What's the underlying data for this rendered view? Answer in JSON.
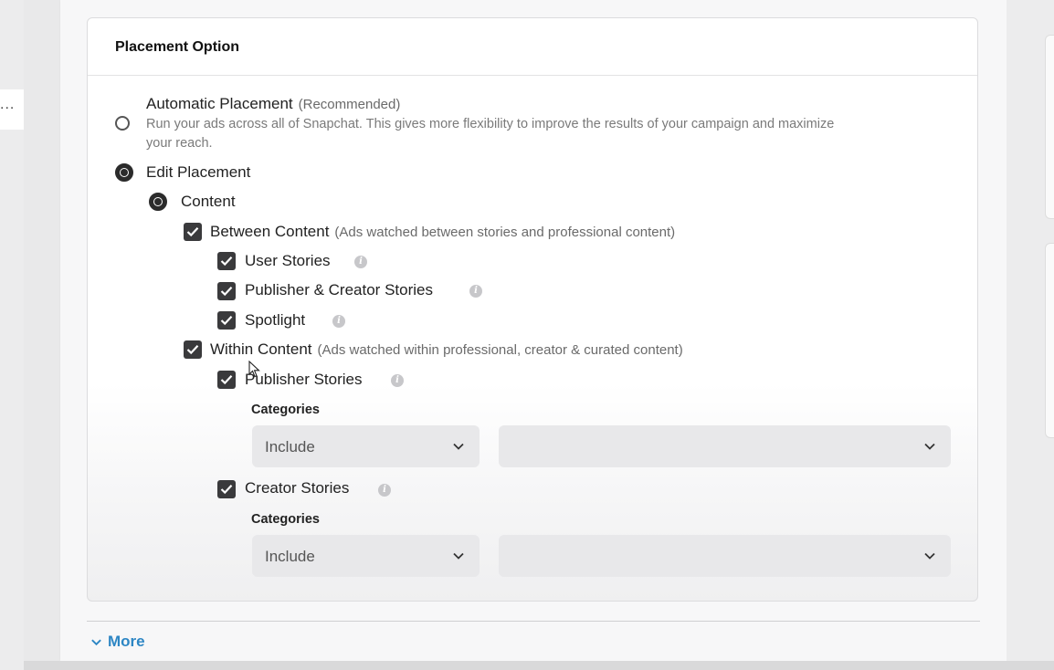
{
  "sidebar": {
    "overflow_indicator": "..."
  },
  "placement": {
    "title": "Placement Option",
    "automatic": {
      "label": "Automatic Placement",
      "tag": "(Recommended)",
      "description_line1": "Run your ads across all of Snapchat. This gives more flexibility to improve the results of your campaign and maximize",
      "description_line2": "your reach.",
      "selected": false
    },
    "edit": {
      "label": "Edit Placement",
      "selected": true
    },
    "content": {
      "label": "Content",
      "selected": true
    },
    "between": {
      "label": "Between Content",
      "hint": "(Ads watched between stories and professional content)",
      "checked": true,
      "items": [
        {
          "label": "User Stories",
          "checked": true,
          "info_icon": "info-icon"
        },
        {
          "label": "Publisher & Creator Stories",
          "checked": true,
          "info_icon": "info-icon"
        },
        {
          "label": "Spotlight",
          "checked": true,
          "info_icon": "info-icon"
        }
      ]
    },
    "within": {
      "label": "Within Content",
      "hint": "(Ads watched within professional, creator & curated content)",
      "checked": true,
      "publisher": {
        "label": "Publisher Stories",
        "checked": true,
        "categories_label": "Categories",
        "include_value": "Include",
        "categories_value": ""
      },
      "creator": {
        "label": "Creator Stories",
        "checked": true,
        "categories_label": "Categories",
        "include_value": "Include",
        "categories_value": ""
      }
    }
  },
  "footer": {
    "more_label": "More",
    "more_color": "#2d86c4"
  },
  "icons": {
    "info_glyph": "i"
  }
}
